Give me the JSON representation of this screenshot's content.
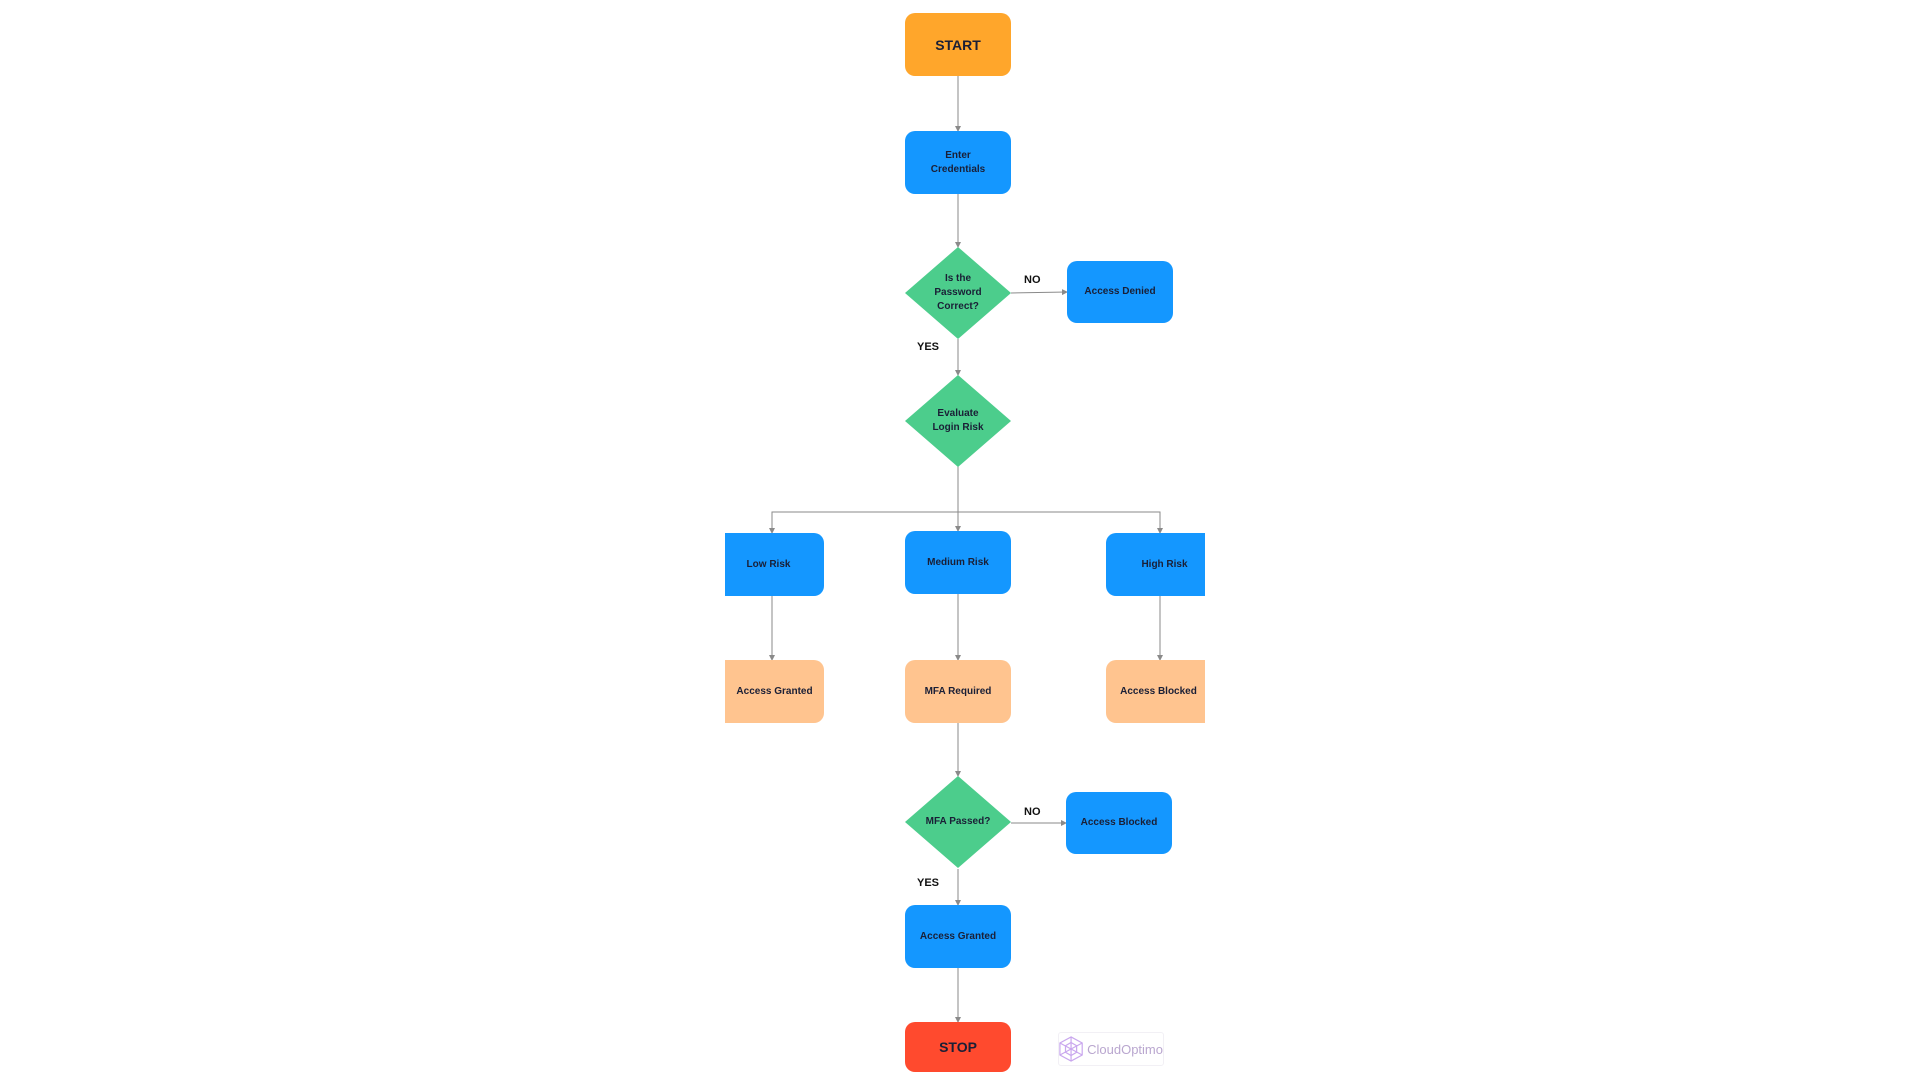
{
  "diagram": {
    "type": "flowchart",
    "colors": {
      "terminal_start": "#FFA62B",
      "terminal_stop": "#FF4A2E",
      "process": "#1497FF",
      "decision": "#4CCD8C",
      "outcome": "#FFC48F",
      "connector": "#8a8a8a",
      "logo": "#c9a7ee"
    },
    "nodes": {
      "start": {
        "label": "START",
        "kind": "terminal"
      },
      "enter_credentials": {
        "label": "Enter Credentials",
        "line1": "Enter",
        "line2": "Credentials",
        "kind": "process"
      },
      "password_check": {
        "label": "Is the Password Correct?",
        "kind": "decision"
      },
      "access_denied": {
        "label": "Access Denied",
        "kind": "process"
      },
      "evaluate_risk": {
        "label": "Evaluate Login Risk",
        "kind": "decision"
      },
      "low_risk": {
        "label": "Low Risk",
        "kind": "process"
      },
      "medium_risk": {
        "label": "Medium Risk",
        "kind": "process"
      },
      "high_risk": {
        "label": "High Risk",
        "kind": "process"
      },
      "low_access_granted": {
        "label": "Access Granted",
        "kind": "outcome"
      },
      "mfa_required": {
        "label": "MFA Required",
        "kind": "outcome"
      },
      "high_access_blocked": {
        "label": "Access Blocked",
        "kind": "outcome"
      },
      "mfa_check": {
        "label": "MFA Passed?",
        "kind": "decision"
      },
      "mfa_access_blocked": {
        "label": "Access Blocked",
        "kind": "process"
      },
      "final_access_granted": {
        "label": "Access Granted",
        "kind": "process"
      },
      "stop": {
        "label": "STOP",
        "kind": "terminal"
      }
    },
    "edges": [
      {
        "from": "start",
        "to": "enter_credentials",
        "label": ""
      },
      {
        "from": "enter_credentials",
        "to": "password_check",
        "label": ""
      },
      {
        "from": "password_check",
        "to": "access_denied",
        "label": "NO"
      },
      {
        "from": "password_check",
        "to": "evaluate_risk",
        "label": "YES"
      },
      {
        "from": "evaluate_risk",
        "to": "low_risk",
        "label": ""
      },
      {
        "from": "evaluate_risk",
        "to": "medium_risk",
        "label": ""
      },
      {
        "from": "evaluate_risk",
        "to": "high_risk",
        "label": ""
      },
      {
        "from": "low_risk",
        "to": "low_access_granted",
        "label": ""
      },
      {
        "from": "medium_risk",
        "to": "mfa_required",
        "label": ""
      },
      {
        "from": "high_risk",
        "to": "high_access_blocked",
        "label": ""
      },
      {
        "from": "mfa_required",
        "to": "mfa_check",
        "label": ""
      },
      {
        "from": "mfa_check",
        "to": "mfa_access_blocked",
        "label": "NO"
      },
      {
        "from": "mfa_check",
        "to": "final_access_granted",
        "label": "YES"
      },
      {
        "from": "final_access_granted",
        "to": "stop",
        "label": ""
      }
    ],
    "edge_labels": {
      "password_no": "NO",
      "password_yes": "YES",
      "mfa_no": "NO",
      "mfa_yes": "YES"
    }
  },
  "watermark": {
    "text": "CloudOptimo",
    "icon": "cube-logo-icon"
  }
}
